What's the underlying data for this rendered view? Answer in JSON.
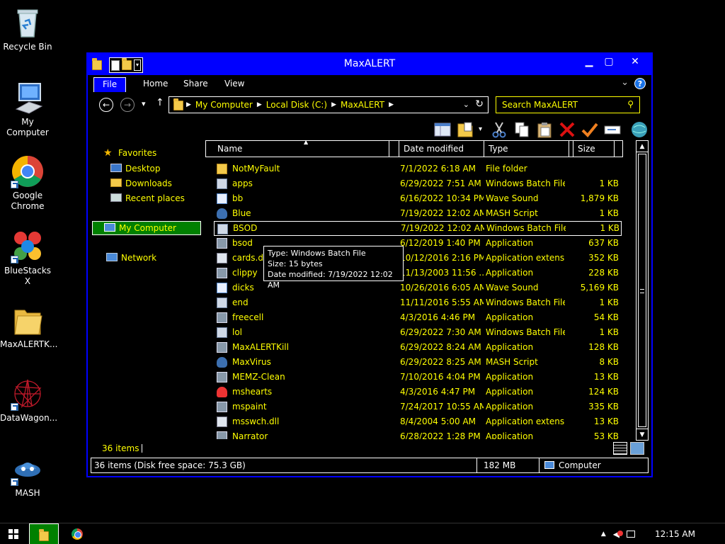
{
  "desktop": {
    "icons": [
      {
        "label": "Recycle Bin"
      },
      {
        "label": "My Computer"
      },
      {
        "label": "Google Chrome"
      },
      {
        "label": "BlueStacks X"
      },
      {
        "label": "MaxALERTK..."
      },
      {
        "label": "DataWagon..."
      },
      {
        "label": "MASH"
      }
    ]
  },
  "window": {
    "title": "MaxALERT",
    "tabs": [
      "File",
      "Home",
      "Share",
      "View"
    ],
    "address": {
      "crumbs": [
        "My Computer",
        "Local Disk (C:)",
        "MaxALERT"
      ]
    },
    "search": {
      "placeholder": "Search MaxALERT"
    },
    "nav": {
      "favorites": "Favorites",
      "desktop": "Desktop",
      "downloads": "Downloads",
      "recent": "Recent places",
      "computer": "My Computer",
      "network": "Network"
    },
    "columns": {
      "name": "Name",
      "date": "Date modified",
      "type": "Type",
      "size": "Size"
    },
    "files": [
      {
        "name": "NotMyFault",
        "date": "7/1/2022 6:18 AM",
        "type": "File folder",
        "size": "",
        "icon": "folder-icon"
      },
      {
        "name": "apps",
        "date": "6/29/2022 7:51 AM",
        "type": "Windows Batch File",
        "size": "1 KB",
        "icon": "batch-file-icon"
      },
      {
        "name": "bb",
        "date": "6/16/2022 10:34 PM",
        "type": "Wave Sound",
        "size": "1,879 KB",
        "icon": "wave-sound-icon"
      },
      {
        "name": "Blue",
        "date": "7/19/2022 12:02 AM",
        "type": "MASH Script",
        "size": "1 KB",
        "icon": "mash-script-icon"
      },
      {
        "name": "BSOD",
        "date": "7/19/2022 12:02 AM",
        "type": "Windows Batch File",
        "size": "1 KB",
        "icon": "batch-file-icon"
      },
      {
        "name": "bsod",
        "date": "6/12/2019 1:40 PM",
        "type": "Application",
        "size": "637 KB",
        "icon": "application-icon"
      },
      {
        "name": "cards.dll",
        "date": "10/12/2016 2:16 PM",
        "type": "Application extens...",
        "size": "352 KB",
        "icon": "dll-icon"
      },
      {
        "name": "clippy",
        "date": "11/13/2003 11:56 ...",
        "type": "Application",
        "size": "228 KB",
        "icon": "application-icon"
      },
      {
        "name": "dicks",
        "date": "10/26/2016 6:05 AM",
        "type": "Wave Sound",
        "size": "5,169 KB",
        "icon": "wave-sound-icon"
      },
      {
        "name": "end",
        "date": "11/11/2016 5:55 AM",
        "type": "Windows Batch File",
        "size": "1 KB",
        "icon": "batch-file-icon"
      },
      {
        "name": "freecell",
        "date": "4/3/2016 4:46 PM",
        "type": "Application",
        "size": "54 KB",
        "icon": "application-icon"
      },
      {
        "name": "lol",
        "date": "6/29/2022 7:30 AM",
        "type": "Windows Batch File",
        "size": "1 KB",
        "icon": "batch-file-icon"
      },
      {
        "name": "MaxALERTKill",
        "date": "6/29/2022 8:24 AM",
        "type": "Application",
        "size": "128 KB",
        "icon": "application-icon"
      },
      {
        "name": "MaxVirus",
        "date": "6/29/2022 8:25 AM",
        "type": "MASH Script",
        "size": "8 KB",
        "icon": "mash-script-icon"
      },
      {
        "name": "MEMZ-Clean",
        "date": "7/10/2016 4:04 PM",
        "type": "Application",
        "size": "13 KB",
        "icon": "application-icon"
      },
      {
        "name": "mshearts",
        "date": "4/3/2016 4:47 PM",
        "type": "Application",
        "size": "124 KB",
        "icon": "hearts-icon"
      },
      {
        "name": "mspaint",
        "date": "7/24/2017 10:55 AM",
        "type": "Application",
        "size": "335 KB",
        "icon": "paint-icon"
      },
      {
        "name": "msswch.dll",
        "date": "8/4/2004 5:00 AM",
        "type": "Application extens...",
        "size": "13 KB",
        "icon": "dll-icon"
      },
      {
        "name": "Narrator",
        "date": "6/28/2022 1:28 PM",
        "type": "Application",
        "size": "53 KB",
        "icon": "application-icon"
      }
    ],
    "selected_row": 4,
    "tooltip": {
      "type": "Type: Windows Batch File",
      "size": "Size: 15 bytes",
      "date": "Date modified: 7/19/2022 12:02 AM"
    },
    "item_count": "36 items",
    "status": {
      "left": "36 items (Disk free space: 75.3 GB)",
      "middle": "182 MB",
      "right": "Computer"
    }
  },
  "taskbar": {
    "clock": "12:15 AM"
  }
}
